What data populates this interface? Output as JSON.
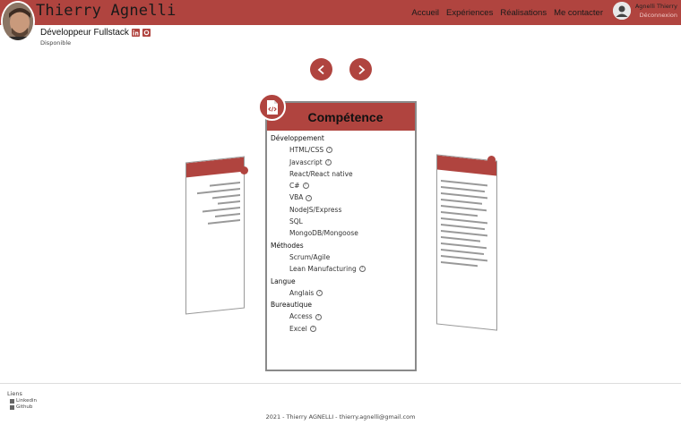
{
  "header": {
    "name": "Thierry Agnelli",
    "nav": [
      "Accueil",
      "Expériences",
      "Réalisations",
      "Me contacter"
    ],
    "user_name": "Agnelli Thierry",
    "logout": "Déconnexion"
  },
  "profile": {
    "role": "Développeur Fullstack",
    "status": "Disponible"
  },
  "card": {
    "title": "Compétence",
    "sections": [
      {
        "name": "Développement",
        "items": [
          {
            "label": "HTML/CSS",
            "help": true
          },
          {
            "label": "Javascript",
            "help": true
          },
          {
            "label": "React/React native",
            "help": false
          },
          {
            "label": "C#",
            "help": true
          },
          {
            "label": "VBA",
            "help": true
          },
          {
            "label": "NodeJS/Express",
            "help": false
          },
          {
            "label": "SQL",
            "help": false
          },
          {
            "label": "MongoDB/Mongoose",
            "help": false
          }
        ]
      },
      {
        "name": "Méthodes",
        "items": [
          {
            "label": "Scrum/Agile",
            "help": false
          },
          {
            "label": "Lean Manufacturing",
            "help": true
          }
        ]
      },
      {
        "name": "Langue",
        "items": [
          {
            "label": "Anglais",
            "help": true
          }
        ]
      },
      {
        "name": "Bureautique",
        "items": [
          {
            "label": "Access",
            "help": true
          },
          {
            "label": "Excel",
            "help": true
          }
        ]
      }
    ]
  },
  "footer": {
    "links_title": "Liens",
    "linkedin": "Linkedin",
    "github": "Github",
    "copyright": "2021 - Thierry AGNELLI - thierry.agnelli@gmail.com"
  },
  "colors": {
    "accent": "#b0443f"
  }
}
